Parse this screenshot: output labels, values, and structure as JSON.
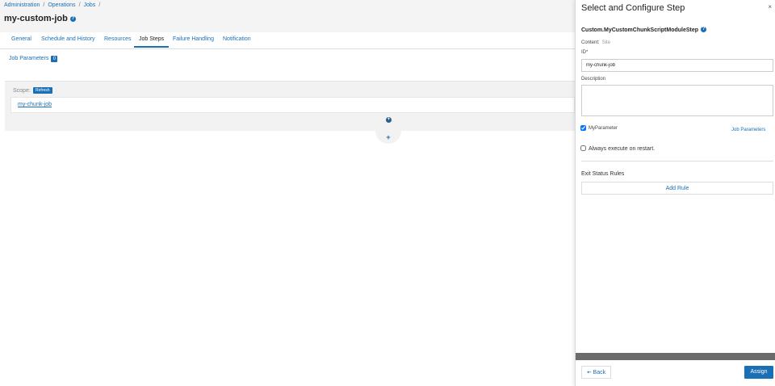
{
  "breadcrumb": [
    "Administration",
    "Operations",
    "Jobs"
  ],
  "page_title": "my-custom-job",
  "tabs": [
    {
      "label": "General",
      "active": false
    },
    {
      "label": "Schedule and History",
      "active": false
    },
    {
      "label": "Resources",
      "active": false
    },
    {
      "label": "Job Steps",
      "active": true
    },
    {
      "label": "Failure Handling",
      "active": false
    },
    {
      "label": "Notification",
      "active": false
    }
  ],
  "job_parameters": {
    "label": "Job Parameters",
    "count": "0"
  },
  "steps": {
    "scope_label": "Scope:",
    "refresh_label": "Refresh",
    "step_name": "my-chunk-job",
    "add_symbol": "+"
  },
  "panel": {
    "title": "Select and Configure Step",
    "close_symbol": "×",
    "step_class": "Custom.MyCustomChunkScriptModuleStep",
    "content_label": "Content:",
    "content_value": "Site",
    "id_label": "ID*",
    "id_value": "my-chunk-job",
    "description_label": "Description",
    "description_value": "",
    "param_label": "MyParameter",
    "param_checked": true,
    "param_link": "Job Parameters",
    "restart_label": "Always execute on restart.",
    "restart_checked": false,
    "exit_status_label": "Exit Status Rules",
    "add_rule_label": "Add Rule",
    "back_label": "Back",
    "assign_label": "Assign"
  },
  "colors": {
    "accent": "#1a6fb5",
    "header_bg": "#f4f4f4",
    "panel_bar": "#6b6b6b"
  }
}
